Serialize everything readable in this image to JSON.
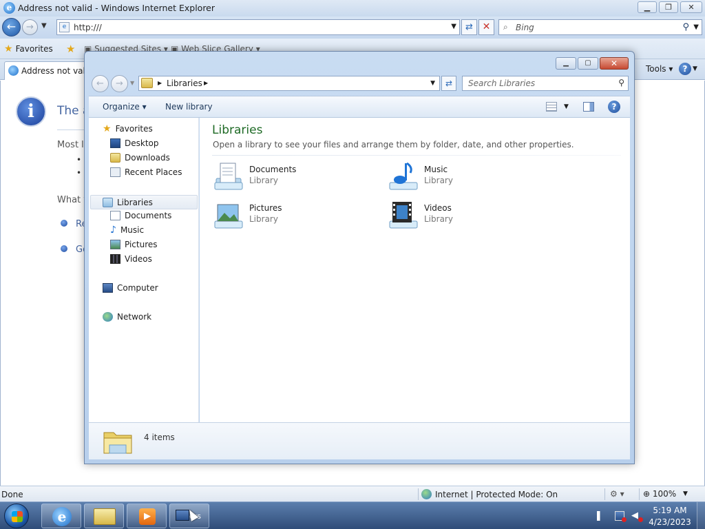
{
  "ie": {
    "title": "Address not valid - Windows Internet Explorer",
    "address": "http:///",
    "search_placeholder": "Bing",
    "favorites_label": "Favorites",
    "suggested_sites": "Suggested Sites",
    "web_slice_gallery": "Web Slice Gallery",
    "tab_label": "Address not valid",
    "tools_label": "Tools",
    "content": {
      "title_fragment": "The a",
      "line1": "Most l",
      "what_fragment": "What y",
      "link1_fragment": "Re",
      "link2_fragment": "Go"
    },
    "status": {
      "left": "Done",
      "zone": "Internet | Protected Mode: On",
      "zoom": "100%"
    }
  },
  "explorer": {
    "breadcrumb": "Libraries",
    "search_placeholder": "Search Libraries",
    "commands": {
      "organize": "Organize",
      "new_library": "New library"
    },
    "nav": {
      "favorites": "Favorites",
      "desktop": "Desktop",
      "downloads": "Downloads",
      "recent_places": "Recent Places",
      "libraries": "Libraries",
      "documents": "Documents",
      "music": "Music",
      "pictures": "Pictures",
      "videos": "Videos",
      "computer": "Computer",
      "network": "Network"
    },
    "main": {
      "title": "Libraries",
      "subtitle": "Open a library to see your files and arrange them by folder, date, and other properties.",
      "items": [
        {
          "name": "Documents",
          "type": "Library"
        },
        {
          "name": "Music",
          "type": "Library"
        },
        {
          "name": "Pictures",
          "type": "Library"
        },
        {
          "name": "Videos",
          "type": "Library"
        }
      ]
    },
    "details": "4 items"
  },
  "taskbar": {
    "active_label": "ers",
    "time": "5:19 AM",
    "date": "4/23/2023"
  }
}
